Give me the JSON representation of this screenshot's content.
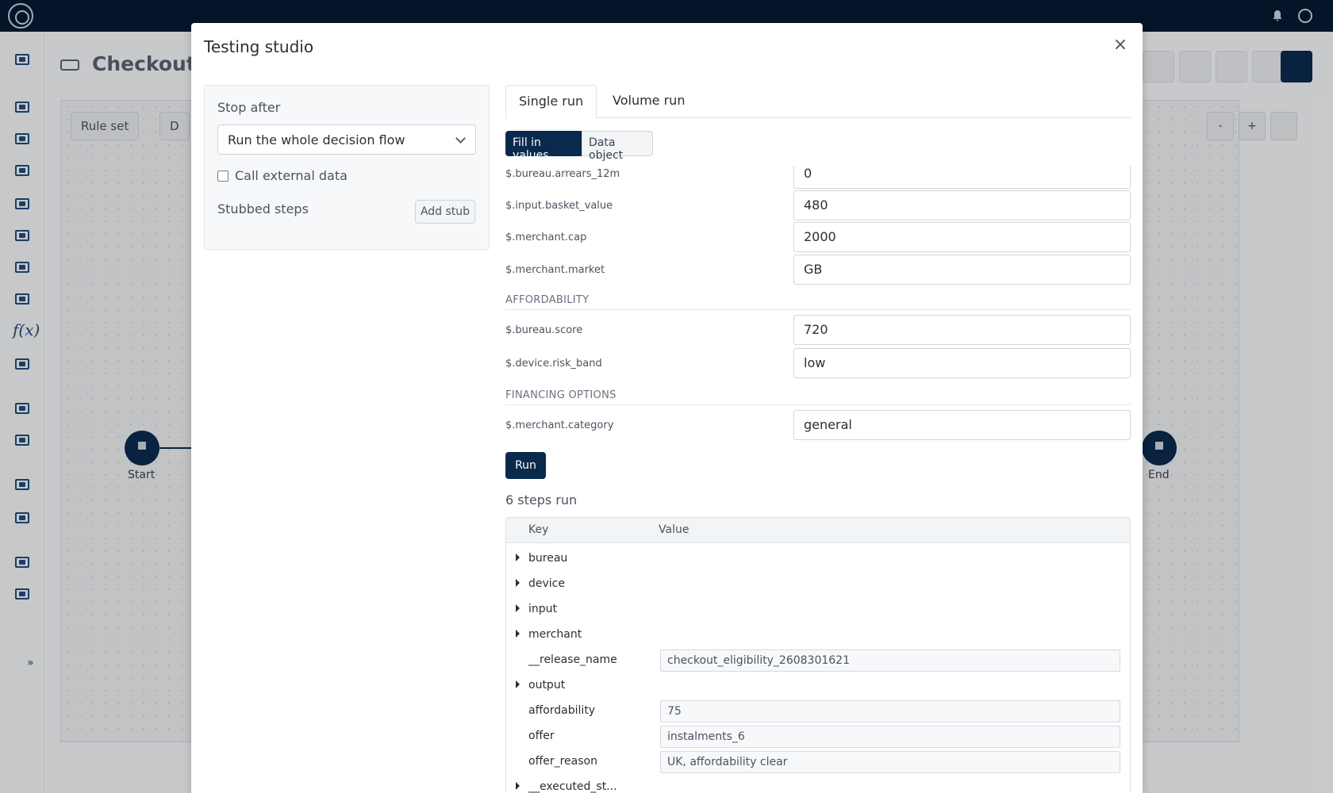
{
  "background": {
    "page_title": "Checkout e",
    "toolbar": {
      "rule_set": "Rule set",
      "d": "D"
    },
    "canvas_controls": {
      "minus": "-",
      "plus": "+"
    },
    "nodes": {
      "start": "Start",
      "end": "End"
    }
  },
  "nav": {
    "more": "»",
    "fx": "f(x)"
  },
  "modal": {
    "title": "Testing studio",
    "close": "×",
    "left": {
      "stop_after_label": "Stop after",
      "stop_after_value": "Run the whole decision flow",
      "call_external_label": "Call external data",
      "stubbed_steps_label": "Stubbed steps",
      "add_stub": "Add stub"
    },
    "tabs": [
      "Single run",
      "Volume run"
    ],
    "modes": [
      "Fill in values",
      "Data object"
    ],
    "fields": [
      {
        "label": "$.bureau.arrears_12m",
        "value": "0"
      },
      {
        "label": "$.input.basket_value",
        "value": "480"
      },
      {
        "label": "$.merchant.cap",
        "value": "2000"
      },
      {
        "label": "$.merchant.market",
        "value": "GB"
      }
    ],
    "section_affordability": "AFFORDABILITY",
    "fields_affordability": [
      {
        "label": "$.bureau.score",
        "value": "720"
      },
      {
        "label": "$.device.risk_band",
        "value": "low"
      }
    ],
    "section_financing": "FINANCING OPTIONS",
    "fields_financing": [
      {
        "label": "$.merchant.category",
        "value": "general"
      }
    ],
    "run_button": "Run",
    "steps_run": "6 steps run",
    "result": {
      "key_header": "Key",
      "value_header": "Value",
      "rows": [
        {
          "key": "bureau",
          "expandable": true,
          "value": ""
        },
        {
          "key": "device",
          "expandable": true,
          "value": ""
        },
        {
          "key": "input",
          "expandable": true,
          "value": ""
        },
        {
          "key": "merchant",
          "expandable": true,
          "value": ""
        },
        {
          "key": "__release_name",
          "expandable": false,
          "value": "checkout_eligibility_2608301621"
        },
        {
          "key": "output",
          "expandable": true,
          "value": ""
        },
        {
          "key": "affordability",
          "expandable": false,
          "value": "75"
        },
        {
          "key": "offer",
          "expandable": false,
          "value": "instalments_6"
        },
        {
          "key": "offer_reason",
          "expandable": false,
          "value": "UK, affordability clear"
        },
        {
          "key": "__executed_st...",
          "expandable": true,
          "value": ""
        }
      ]
    }
  },
  "colors": {
    "navy": "#0a2a4d",
    "topbar": "#061a33"
  }
}
